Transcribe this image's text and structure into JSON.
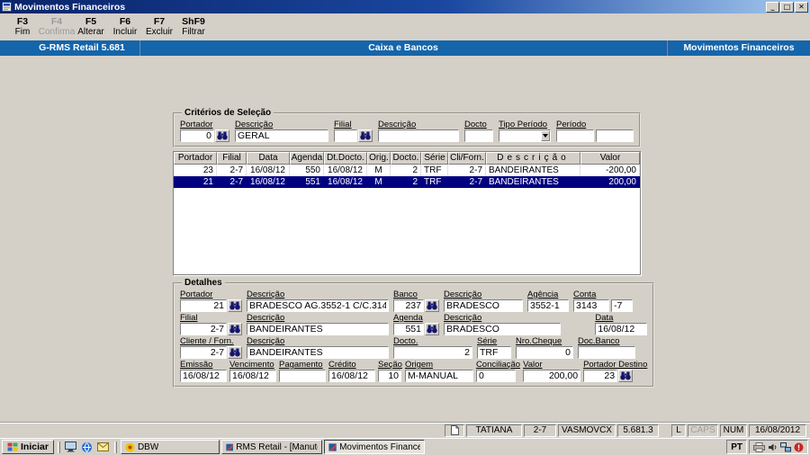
{
  "window": {
    "title": "Movimentos Financeiros"
  },
  "icons": {
    "minimize": "_",
    "maximize": "□",
    "close": "✕",
    "search": "binoculars",
    "dropdown": "▼",
    "window_logo": "windows-flag",
    "document": "blank-page"
  },
  "colors": {
    "titlebar": "#0a246a",
    "titlebar_light": "#a6caf0",
    "header_blue": "#1565ab",
    "chrome": "#d4d0c8",
    "selection": "#000080",
    "field_bg": "#ffffff"
  },
  "toolbar": {
    "buttons": [
      {
        "key": "F3",
        "label": "Fim",
        "enabled": true
      },
      {
        "key": "F4",
        "label": "Confirma",
        "enabled": false
      },
      {
        "key": "F5",
        "label": "Alterar",
        "enabled": true
      },
      {
        "key": "F6",
        "label": "Incluir",
        "enabled": true
      },
      {
        "key": "F7",
        "label": "Excluir",
        "enabled": true
      },
      {
        "key": "ShF9",
        "label": "Filtrar",
        "enabled": true
      }
    ]
  },
  "header": {
    "product": "G-RMS Retail 5.681",
    "module": "Caixa e Bancos",
    "screen": "Movimentos Financeiros"
  },
  "criteria": {
    "legend": "Critérios de Seleção",
    "portador": {
      "label": "Portador",
      "value": "0"
    },
    "descricao_portador": {
      "label": "Descrição",
      "value": "GERAL"
    },
    "filial": {
      "label": "Filial",
      "value": ""
    },
    "descricao_filial": {
      "label": "Descrição",
      "value": ""
    },
    "docto": {
      "label": "Docto",
      "value": ""
    },
    "tipo_periodo": {
      "label": "Tipo Período",
      "value": ""
    },
    "periodo": {
      "label": "Período",
      "from": "",
      "to": ""
    }
  },
  "grid": {
    "columns": [
      "Portador",
      "Filial",
      "Data",
      "Agenda",
      "Dt.Docto.",
      "Orig.",
      "Docto.",
      "Série",
      "Cli/Forn.",
      "Descrição",
      "Valor"
    ],
    "rows": [
      {
        "selected": false,
        "cells": [
          "23",
          "2-7",
          "16/08/12",
          "550",
          "16/08/12",
          "M",
          "2",
          "TRF",
          "2-7",
          "BANDEIRANTES",
          "-200,00"
        ]
      },
      {
        "selected": true,
        "cells": [
          "21",
          "2-7",
          "16/08/12",
          "551",
          "16/08/12",
          "M",
          "2",
          "TRF",
          "2-7",
          "BANDEIRANTES",
          "200,00"
        ]
      }
    ]
  },
  "details": {
    "legend": "Detalhes",
    "portador": {
      "label": "Portador",
      "value": "21"
    },
    "portador_desc": {
      "label": "Descrição",
      "value": "BRADESCO AG.3552-1 C/C.3143-7"
    },
    "banco": {
      "label": "Banco",
      "value": "237"
    },
    "banco_desc": {
      "label": "Descrição",
      "value": "BRADESCO"
    },
    "agencia": {
      "label": "Agência",
      "value": "3552-1"
    },
    "conta": {
      "label": "Conta",
      "value": "3143",
      "digit": "-7"
    },
    "filial": {
      "label": "Filial",
      "value": "2-7"
    },
    "filial_desc": {
      "label": "Descrição",
      "value": "BANDEIRANTES"
    },
    "agenda": {
      "label": "Agenda",
      "value": "551"
    },
    "agenda_desc": {
      "label": "Descrição",
      "value": "BRADESCO"
    },
    "data": {
      "label": "Data",
      "value": "16/08/12"
    },
    "cliente": {
      "label": "Cliente / Forn.",
      "value": "2-7"
    },
    "cliente_desc": {
      "label": "Descrição",
      "value": "BANDEIRANTES"
    },
    "docto": {
      "label": "Docto.",
      "value": "2"
    },
    "serie": {
      "label": "Série",
      "value": "TRF"
    },
    "nro_cheque": {
      "label": "Nro.Cheque",
      "value": "0"
    },
    "doc_banco": {
      "label": "Doc.Banco",
      "value": ""
    },
    "emissao": {
      "label": "Emissão",
      "value": "16/08/12"
    },
    "vencimento": {
      "label": "Vencimento",
      "value": "16/08/12"
    },
    "pagamento": {
      "label": "Pagamento",
      "value": ""
    },
    "credito": {
      "label": "Crédito",
      "value": "16/08/12"
    },
    "secao": {
      "label": "Seção",
      "value": "10"
    },
    "origem": {
      "label": "Origem",
      "value": "M-MANUAL"
    },
    "conciliacao": {
      "label": "Conciliação",
      "value": "0"
    },
    "valor": {
      "label": "Valor",
      "value": "200,00"
    },
    "portador_destino": {
      "label": "Portador Destino",
      "value": "23"
    }
  },
  "statusbar": {
    "user": "TATIANA",
    "filial": "2-7",
    "program": "VASMOVCX",
    "version": "5.681.3",
    "lock": "L",
    "caps": "CAPS",
    "num": "NUM",
    "date": "16/08/2012"
  },
  "taskbar": {
    "start_label": "Iniciar",
    "tasks": [
      {
        "label": "DBW",
        "active": false
      },
      {
        "label": "RMS Retail - [Manutenca...",
        "active": false
      },
      {
        "label": "Movimentos Financeiros",
        "active": true
      }
    ],
    "language": "PT"
  }
}
